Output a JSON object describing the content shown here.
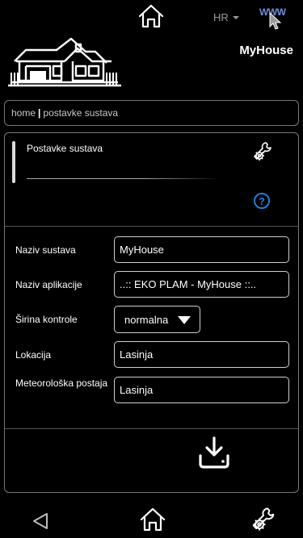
{
  "header": {
    "language": "HR",
    "app_title": "MyHouse",
    "icons": {
      "home": "home-icon",
      "www": "www-cursor-icon",
      "logo": "house-logo"
    }
  },
  "breadcrumb": {
    "home": "home",
    "separator": "|",
    "current": "postavke sustava"
  },
  "panel": {
    "title": "Postavke sustava",
    "help": "?",
    "fields": {
      "system_name": {
        "label": "Naziv sustava",
        "value": "MyHouse"
      },
      "app_name": {
        "label": "Naziv aplikacije",
        "value": "..:: EKO PLAM - MyHouse ::.."
      },
      "control_width": {
        "label": "Širina kontrole",
        "value": "normalna"
      },
      "location": {
        "label": "Lokacija",
        "value": "Lasinja"
      },
      "weather_station": {
        "label": "Meteorološka postaja",
        "value": "Lasinja"
      }
    }
  },
  "footer_nav": {
    "icons": {
      "back": "back-triangle-icon",
      "home": "home-icon",
      "settings": "tools-icon"
    }
  },
  "colors": {
    "accent": "#1e7fd6",
    "background": "#000000",
    "border": "#777777"
  }
}
